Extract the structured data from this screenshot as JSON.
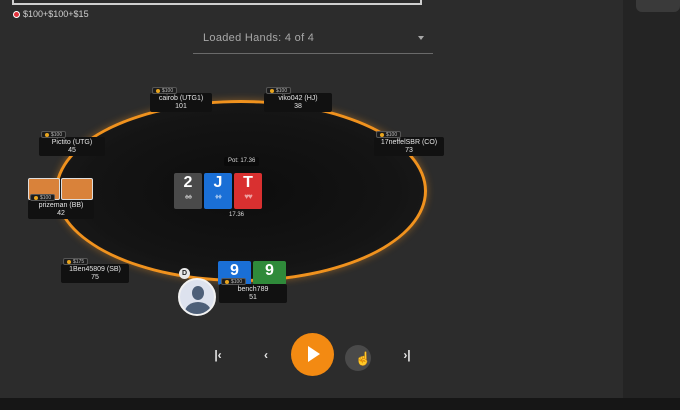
{
  "header": {
    "stakes": "$100+$100+$15"
  },
  "hand_selector": {
    "label": "Loaded Hands: 4 of 4"
  },
  "table": {
    "pot_label": "Pot: 17.36",
    "pot_amount": "17.36",
    "board": [
      {
        "rank": "2",
        "suit": "♠♠",
        "color": "#4a4a4a"
      },
      {
        "rank": "J",
        "suit": "♦♦",
        "color": "#1a6fd6"
      },
      {
        "rank": "T",
        "suit": "♥♥",
        "color": "#d93030"
      }
    ],
    "hero_cards": [
      {
        "rank": "9",
        "suit": "♦♦",
        "color": "#1a6fd6"
      },
      {
        "rank": "9",
        "suit": "♣♣",
        "color": "#2f8a3a"
      }
    ]
  },
  "seats": [
    {
      "id": "utg1",
      "name": "cairob (UTG1)",
      "stack": "101",
      "bet": "$100"
    },
    {
      "id": "hj",
      "name": "viko042 (HJ)",
      "stack": "38",
      "bet": "$100"
    },
    {
      "id": "utg",
      "name": "Pictito (UTG)",
      "stack": "45",
      "bet": "$100"
    },
    {
      "id": "co",
      "name": "17neffelSBR (CO)",
      "stack": "73",
      "bet": "$100"
    },
    {
      "id": "bb",
      "name": "prizeman (BB)",
      "stack": "42",
      "bet": "$100"
    },
    {
      "id": "sb",
      "name": "1Ben45809 (SB)",
      "stack": "75",
      "bet": "$175"
    },
    {
      "id": "hero",
      "name": "bench789",
      "stack": "51",
      "bet": "$100"
    }
  ],
  "dealer_button": "D",
  "controls": {
    "first": "|‹",
    "prev": "‹",
    "last": "›|"
  },
  "colors": {
    "accent": "#f38a12",
    "rail": "#f0921e",
    "bb_card_back": "#d9823a"
  }
}
